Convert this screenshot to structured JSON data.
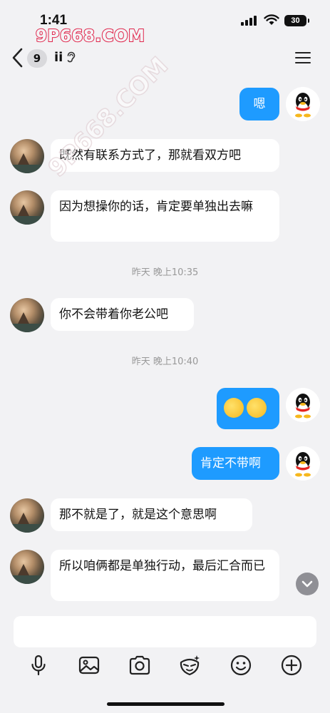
{
  "status_bar": {
    "time": "1:41",
    "battery": "30",
    "watermark": "9P668.COM"
  },
  "header": {
    "unread_count": "9",
    "contact_name": "ii"
  },
  "watermark_diagonal": "9P668.COM",
  "messages": [
    {
      "side": "right",
      "text": "嗯"
    },
    {
      "side": "left",
      "text": "既然有联系方式了，那就看双方吧"
    },
    {
      "side": "left",
      "text": "因为想操你的话，肯定要单独出去嘛"
    },
    {
      "side": "time",
      "text": "昨天 晚上10:35"
    },
    {
      "side": "left",
      "text": "你不会带着你老公吧"
    },
    {
      "side": "time",
      "text": "昨天 晚上10:40"
    },
    {
      "side": "right",
      "text": "",
      "emoji": [
        "laughing-crying-emoji",
        "laughing-crying-emoji"
      ]
    },
    {
      "side": "right",
      "text": "肯定不带啊"
    },
    {
      "side": "left",
      "text": "那不就是了，就是这个意思啊"
    },
    {
      "side": "left",
      "text": "所以咱俩都是单独行动，最后汇合而已"
    }
  ],
  "input": {
    "placeholder": ""
  },
  "toolbar": [
    "microphone-icon",
    "image-icon",
    "camera-icon",
    "sticker-icon",
    "emoji-icon",
    "plus-icon"
  ],
  "colors": {
    "background": "#f2f2f4",
    "outgoing_bubble": "#1e9bff",
    "incoming_bubble": "#ffffff",
    "watermark": "#e0254b"
  }
}
